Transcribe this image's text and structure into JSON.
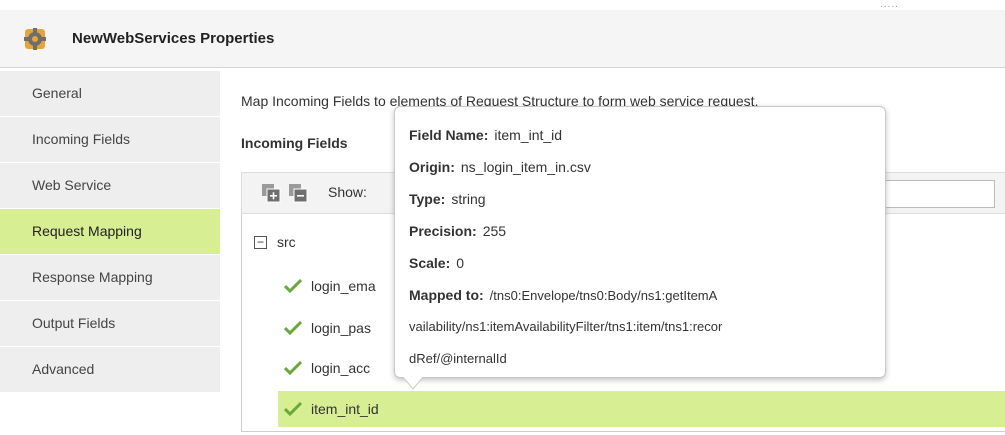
{
  "window": {
    "title": "NewWebServices Properties",
    "icon": "gear-puzzle-icon",
    "dots": "....."
  },
  "sidebar": {
    "items": [
      {
        "label": "General",
        "active": false
      },
      {
        "label": "Incoming Fields",
        "active": false
      },
      {
        "label": "Web Service",
        "active": false
      },
      {
        "label": "Request Mapping",
        "active": true
      },
      {
        "label": "Response Mapping",
        "active": false
      },
      {
        "label": "Output Fields",
        "active": false
      },
      {
        "label": "Advanced",
        "active": false
      }
    ]
  },
  "main": {
    "description": "Map Incoming Fields to elements of Request Structure to form web service request.",
    "incoming_label": "Incoming Fields",
    "toolbar": {
      "expand_icon": "expand-all-icon",
      "collapse_icon": "collapse-all-icon",
      "show_label": "Show:",
      "filter_value": ""
    },
    "tree": {
      "root": "src",
      "rows": [
        {
          "label": "login_ema",
          "mapped": true,
          "selected": false
        },
        {
          "label": "login_pas",
          "mapped": true,
          "selected": false
        },
        {
          "label": "login_acc",
          "mapped": true,
          "selected": false
        },
        {
          "label": "item_int_id",
          "mapped": true,
          "selected": true
        }
      ]
    }
  },
  "tooltip": {
    "field_name_key": "Field Name:",
    "field_name": "item_int_id",
    "origin_key": "Origin:",
    "origin": "ns_login_item_in.csv",
    "type_key": "Type:",
    "type": "string",
    "precision_key": "Precision:",
    "precision": "255",
    "scale_key": "Scale:",
    "scale": "0",
    "mapped_key": "Mapped to:",
    "mapped_line1": "/tns0:Envelope/tns0:Body/ns1:getItemA",
    "mapped_line2": "vailability/ns1:itemAvailabilityFilter/tns1:item/tns1:recor",
    "mapped_line3": "dRef/@internalId"
  },
  "colors": {
    "active_green": "#d7ee93",
    "check_green": "#6aa83a"
  }
}
